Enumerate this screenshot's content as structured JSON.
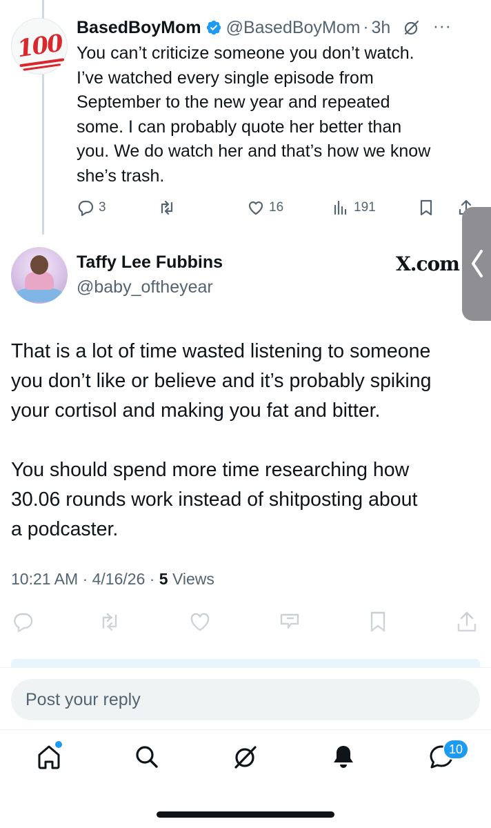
{
  "parent_tweet": {
    "avatar_icon": "hundred-points-emoji",
    "author_name": "BasedBoyMom",
    "handle": "@BasedBoyMom",
    "separator": "·",
    "time": "3h",
    "body_lines": [
      "You can’t criticize someone you don’t watch.",
      "I’ve watched every single episode from",
      "September to the new year and repeated",
      "some. I can probably quote her better than",
      "you. We do watch her and that’s how we know",
      "she’s trash."
    ],
    "actions": {
      "replies": "3",
      "likes": "16",
      "views": "191"
    }
  },
  "main_tweet": {
    "author_name": "Taffy Lee Fubbins",
    "handle": "@baby_oftheyear",
    "site_label": "X.com",
    "paragraph1_lines": [
      "That is a lot of time wasted listening to someone",
      "you don’t like or believe and it’s probably spiking",
      "your cortisol and making you fat and bitter."
    ],
    "paragraph2_lines": [
      "You should spend more time researching how",
      "30.06 rounds work instead of shitposting about",
      "a podcaster."
    ],
    "timestamp": "10:21 AM · 4/16/26 · ",
    "views_count": "5",
    "views_label": " Views"
  },
  "reply": {
    "placeholder": "Post your reply"
  },
  "bottom_nav": {
    "items": [
      "home-icon",
      "search-icon",
      "grok-icon",
      "notifications-icon",
      "messages-icon"
    ],
    "messages_badge": "10"
  },
  "colors": {
    "accent": "#1d9bf0",
    "secondary_text": "#536471",
    "primary_text": "#0f1419"
  }
}
